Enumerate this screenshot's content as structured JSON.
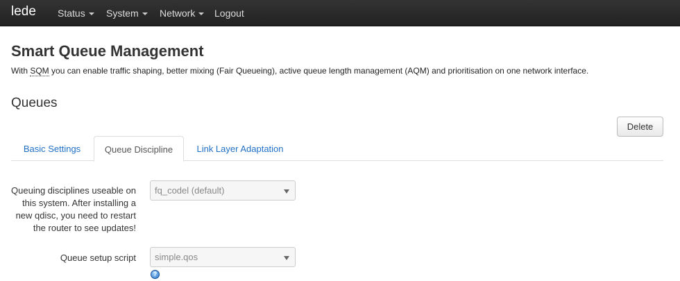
{
  "navbar": {
    "brand": "lede",
    "items": [
      {
        "label": "Status",
        "has_dropdown": true
      },
      {
        "label": "System",
        "has_dropdown": true
      },
      {
        "label": "Network",
        "has_dropdown": true
      },
      {
        "label": "Logout",
        "has_dropdown": false
      }
    ]
  },
  "page": {
    "title": "Smart Queue Management",
    "intro_before": "With ",
    "intro_abbr": "SQM",
    "intro_after": " you can enable traffic shaping, better mixing (Fair Queueing), active queue length management (AQM) and prioritisation on one network interface."
  },
  "section": {
    "title": "Queues",
    "delete_label": "Delete"
  },
  "tabs": [
    {
      "label": "Basic Settings",
      "active": false
    },
    {
      "label": "Queue Discipline",
      "active": true
    },
    {
      "label": "Link Layer Adaptation",
      "active": false
    }
  ],
  "fields": {
    "qdisc": {
      "label": "Queuing disciplines useable on this system. After installing a new qdisc, you need to restart the router to see updates!",
      "label_lines": [
        "Queuing disciplines useable on",
        "this system. After installing a",
        "new qdisc, you need to restart",
        "the router to see updates!"
      ],
      "value": "fq_codel (default)"
    },
    "script": {
      "label": "Queue setup script",
      "value": "simple.qos"
    },
    "help_icon": "help-icon"
  },
  "colors": {
    "navbar": "#222222",
    "link": "#1f6fc5",
    "text": "#333333"
  }
}
